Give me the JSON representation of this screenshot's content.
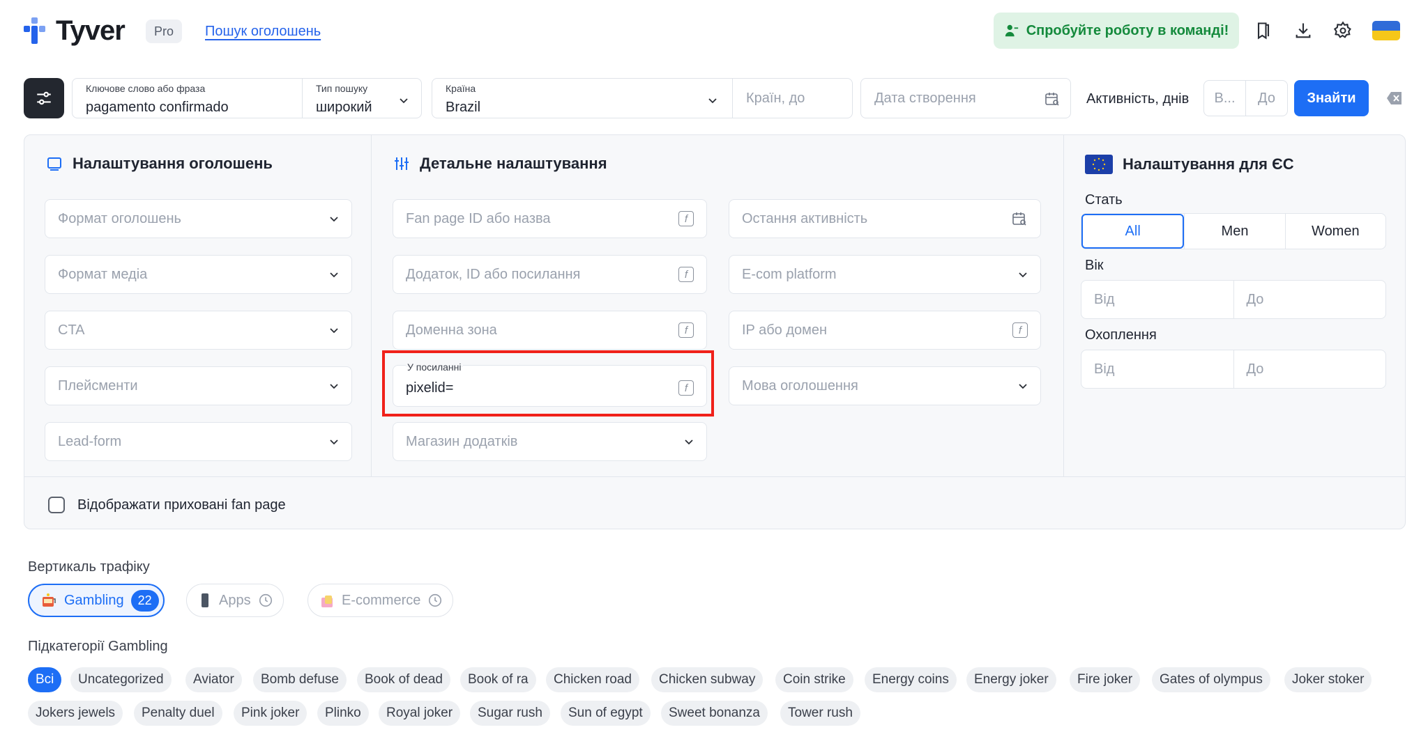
{
  "header": {
    "brand": "Tyver",
    "badge": "Pro",
    "nav_link": "Пошук оголошень",
    "team_button": "Спробуйте роботу в команді!"
  },
  "search": {
    "keyword_label": "Ключове слово або фраза",
    "keyword_value": "pagamento confirmado",
    "type_label": "Тип пошуку",
    "type_value": "широкий",
    "country_label": "Країна",
    "country_value": "Brazil",
    "countries_to_placeholder": "Країн, до",
    "created_placeholder": "Дата створення",
    "activity_label": "Активність, днів",
    "activity_from_placeholder": "В...",
    "activity_to_placeholder": "До",
    "submit": "Знайти"
  },
  "ad_settings": {
    "title": "Налаштування оголошень",
    "selects": [
      "Формат оголошень",
      "Формат медіа",
      "CTA",
      "Плейсменти",
      "Lead-form"
    ]
  },
  "detail": {
    "title": "Детальне налаштування",
    "fanpage_placeholder": "Fan page ID або назва",
    "app_placeholder": "Додаток, ID або посилання",
    "domain_placeholder": "Доменна зона",
    "link_label": "У посиланні",
    "link_value": "pixelid=",
    "store_placeholder": "Магазин додатків",
    "last_activity_placeholder": "Остання активність",
    "ecom_placeholder": "E-com platform",
    "ip_placeholder": "IP або домен",
    "lang_placeholder": "Мова оголошення"
  },
  "eu": {
    "title": "Налаштування для ЄС",
    "gender_label": "Стать",
    "genders": [
      "All",
      "Men",
      "Women"
    ],
    "age_label": "Вік",
    "age_from": "Від",
    "age_to": "До",
    "reach_label": "Охоплення",
    "reach_from": "Від",
    "reach_to": "До"
  },
  "hidden_toggle": "Відображати приховані fan page",
  "verticals": {
    "label": "Вертикаль трафіку",
    "items": [
      {
        "label": "Gambling",
        "count": "22"
      },
      {
        "label": "Apps"
      },
      {
        "label": "E-commerce"
      }
    ]
  },
  "subcategories": {
    "label": "Підкатегорії Gambling",
    "row1": [
      "Всі",
      "Uncategorized",
      "Aviator",
      "Bomb defuse",
      "Book of dead",
      "Book of ra",
      "Chicken road",
      "Chicken subway",
      "Coin strike",
      "Energy coins",
      "Energy joker",
      "Fire joker",
      "Gates of olympus",
      "Joker stoker"
    ],
    "row2": [
      "Jokers jewels",
      "Penalty duel",
      "Pink joker",
      "Plinko",
      "Royal joker",
      "Sugar rush",
      "Sun of egypt",
      "Sweet bonanza",
      "Tower rush"
    ]
  },
  "colors": {
    "accent": "#1d6ef5",
    "highlight": "#f0211a",
    "team_green": "#148a3c"
  }
}
